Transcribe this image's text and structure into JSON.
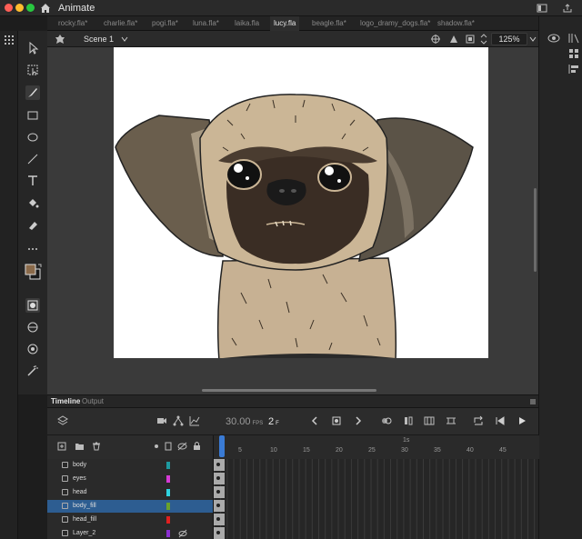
{
  "app": {
    "name": "Animate"
  },
  "tabs": [
    {
      "label": "rocky.fla*",
      "active": false
    },
    {
      "label": "charlie.fla*",
      "active": false
    },
    {
      "label": "pogi.fla*",
      "active": false
    },
    {
      "label": "luna.fla*",
      "active": false
    },
    {
      "label": "laika.fla",
      "active": false
    },
    {
      "label": "lucy.fla",
      "active": true
    },
    {
      "label": "beagle.fla*",
      "active": false
    },
    {
      "label": "logo_dramy_dogs.fla*",
      "active": false
    },
    {
      "label": "shadow.fla*",
      "active": false
    }
  ],
  "scene": {
    "label": "Scene 1",
    "zoom": "125%"
  },
  "timeline": {
    "tab_timeline": "Timeline",
    "tab_output": "Output",
    "fps": "30.00",
    "fps_unit": "FPS",
    "frame": "2",
    "frame_unit": "F",
    "ruler_marker": "1s",
    "ruler_ticks": [
      "5",
      "10",
      "15",
      "20",
      "25",
      "30",
      "35",
      "40",
      "45"
    ],
    "layers": [
      {
        "name": "body",
        "color": "#1e9aa0"
      },
      {
        "name": "eyes",
        "color": "#d63ad6"
      },
      {
        "name": "head",
        "color": "#2fd3e0"
      },
      {
        "name": "body_fill",
        "color": "#6aa12a",
        "selected": true
      },
      {
        "name": "head_fill",
        "color": "#e02020"
      },
      {
        "name": "Layer_2",
        "color": "#8a2fd0",
        "hidden": true
      }
    ]
  },
  "colors": {
    "stroke": "#8a6a4a",
    "fill": "#1a1a1a",
    "accent": "#3a7bd5"
  }
}
